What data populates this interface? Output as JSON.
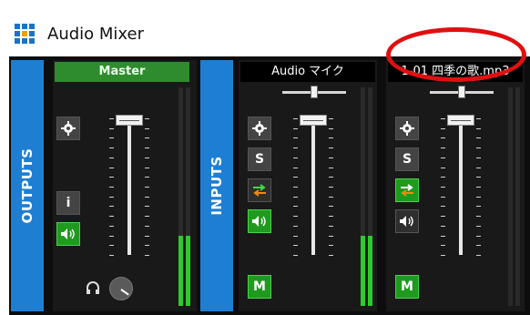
{
  "window": {
    "title": "Audio Mixer"
  },
  "sections": {
    "outputs": "OUTPUTS",
    "inputs": "INPUTS"
  },
  "strips": {
    "master": {
      "name": "Master",
      "info_label": "i",
      "fader_level": 0.9,
      "meter_level": 0.32
    },
    "audio_mic": {
      "name": "Audio マイク",
      "solo_label": "S",
      "mute_label": "M",
      "fader_level": 0.9,
      "meter_level": 0.32
    },
    "mp3": {
      "name": "1-01 四季の歌.mp3",
      "solo_label": "S",
      "mute_label": "M",
      "fader_level": 0.9,
      "meter_level": 0.0
    }
  },
  "colors": {
    "panel": "#191919",
    "section_blue": "#1e7fd2",
    "accent_green": "#1f9a1f",
    "highlight_red": "#e01010"
  }
}
